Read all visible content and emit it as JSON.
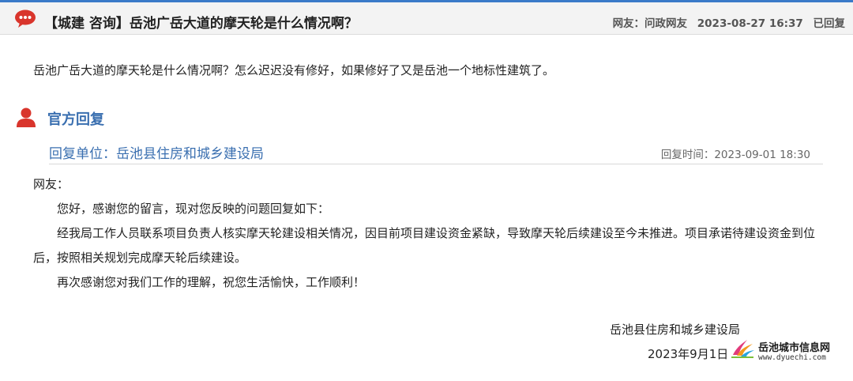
{
  "header": {
    "title": "【城建 咨询】岳池广岳大道的摩天轮是什么情况啊？",
    "netizen_label": "网友：问政网友",
    "datetime": "2023-08-27 16:37",
    "status": "已回复"
  },
  "question": {
    "text": "岳池广岳大道的摩天轮是什么情况啊？怎么迟迟没有修好，如果修好了又是岳池一个地标性建筑了。"
  },
  "official": {
    "heading": "官方回复",
    "unit": "回复单位：岳池县住房和城乡建设局",
    "time": "回复时间：2023-09-01 18:30",
    "greeting": "网友：",
    "paragraphs": [
      "您好，感谢您的留言，现对您反映的问题回复如下：",
      "经我局工作人员联系项目负责人核实摩天轮建设相关情况，因目前项目建设资金紧缺，导致摩天轮后续建设至今未推进。项目承诺待建设资金到位后，按照相关规划完成摩天轮后续建设。",
      "再次感谢您对我们工作的理解，祝您生活愉快，工作顺利！"
    ],
    "signature": "岳池县住房和城乡建设局",
    "date": "2023年9月1日"
  },
  "watermark": {
    "name": "岳池城市信息网",
    "url": "www.dyuechi.com"
  },
  "colors": {
    "accent_blue": "#3a6fb0",
    "icon_red": "#d9352c",
    "top_border": "#3a7ac8"
  },
  "icons": {
    "header": "chat-bubble-icon",
    "official": "person-icon",
    "watermark": "brand-logo-icon"
  }
}
